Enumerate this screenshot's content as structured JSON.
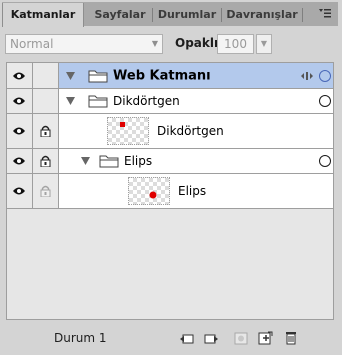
{
  "tabs": [
    {
      "label": "Katmanlar",
      "active": true
    },
    {
      "label": "Sayfalar",
      "active": false
    },
    {
      "label": "Durumlar",
      "active": false
    },
    {
      "label": "Davranışlar",
      "active": false
    }
  ],
  "blend_mode": "Normal",
  "opacity_label": "Opaklık",
  "opacity_value": "100",
  "layers": [
    {
      "name": "Web Katmanı",
      "type": "web-layer",
      "selected": true
    },
    {
      "name": "Dikdörtgen",
      "type": "folder",
      "selected": false
    },
    {
      "name": "Dikdörtgen",
      "type": "object",
      "thumb": "red-square",
      "selected": false
    },
    {
      "name": "Elips",
      "type": "folder",
      "selected": false
    },
    {
      "name": "Elips",
      "type": "object",
      "thumb": "red-dot",
      "selected": false
    }
  ],
  "status": "Durum 1",
  "colors": {
    "selection": "#b3c9ec",
    "thumb_mark": "#e00000",
    "panel": "#d4d4d4"
  },
  "bottom_icons": [
    "share-states-icon",
    "distribute-states-icon",
    "add-mask-icon",
    "new-sublayer-icon",
    "delete-icon"
  ]
}
